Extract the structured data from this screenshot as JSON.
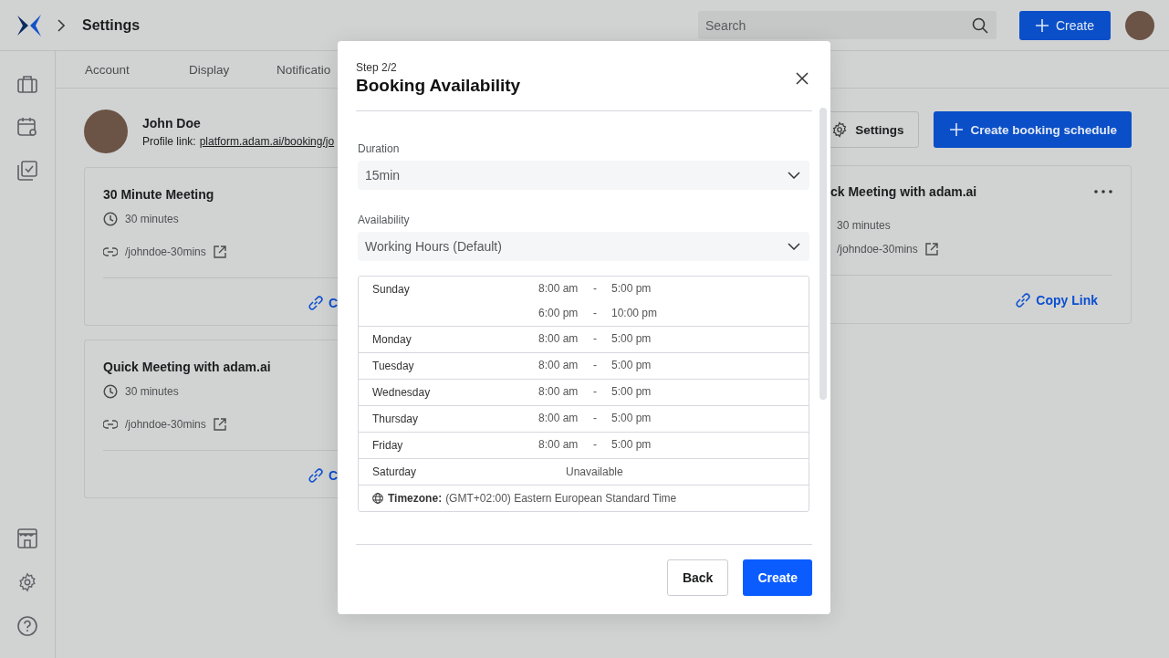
{
  "header": {
    "breadcrumb": "Settings",
    "search": {
      "placeholder": "Search"
    },
    "create_button": "Create"
  },
  "tabs": [
    {
      "label": "Account",
      "selected": false
    },
    {
      "label": "Display",
      "selected": false
    },
    {
      "label": "Notificatio",
      "selected": false
    }
  ],
  "profile": {
    "name": "John Doe",
    "link_label": "Profile link:",
    "link": "platform.adam.ai/booking/jo"
  },
  "actions": {
    "settings_button": "Settings",
    "create_schedule_button": "Create booking schedule"
  },
  "left_cards": [
    {
      "title": "30 Minute Meeting",
      "duration": "30 minutes",
      "slug": "/johndoe-30mins",
      "copy_link": "C"
    },
    {
      "title": "Quick Meeting with adam.ai",
      "duration": "30 minutes",
      "slug": "/johndoe-30mins",
      "copy_link": "C"
    }
  ],
  "right_card": {
    "title": "ck Meeting with adam.ai",
    "duration": "30 minutes",
    "slug": "/johndoe-30mins",
    "copy_link": "Copy Link"
  },
  "modal": {
    "step": "Step 2/2",
    "title": "Booking Availability",
    "duration": {
      "label": "Duration",
      "value": "15min"
    },
    "availability": {
      "label": "Availability",
      "value": "Working Hours (Default)"
    },
    "schedule": [
      {
        "day": "Sunday",
        "kind": "hours",
        "slots": [
          {
            "start": "8:00 am",
            "sep": "-",
            "end": "5:00 pm"
          },
          {
            "start": "6:00 pm",
            "sep": "-",
            "end": "10:00 pm"
          }
        ]
      },
      {
        "day": "Monday",
        "kind": "hours",
        "slots": [
          {
            "start": "8:00 am",
            "sep": "-",
            "end": "5:00 pm"
          }
        ]
      },
      {
        "day": "Tuesday",
        "kind": "hours",
        "slots": [
          {
            "start": "8:00 am",
            "sep": "-",
            "end": "5:00 pm"
          }
        ]
      },
      {
        "day": "Wednesday",
        "kind": "hours",
        "slots": [
          {
            "start": "8:00 am",
            "sep": "-",
            "end": "5:00 pm"
          }
        ]
      },
      {
        "day": "Thursday",
        "kind": "hours",
        "slots": [
          {
            "start": "8:00 am",
            "sep": "-",
            "end": "5:00 pm"
          }
        ]
      },
      {
        "day": "Friday",
        "kind": "hours",
        "slots": [
          {
            "start": "8:00 am",
            "sep": "-",
            "end": "5:00 pm"
          }
        ]
      },
      {
        "day": "Saturday",
        "kind": "unavailable",
        "status": "Unavailable"
      }
    ],
    "timezone": {
      "label": "Timezone:",
      "value": "(GMT+02:00) Eastern European Standard Time"
    },
    "buttons": {
      "back": "Back",
      "create": "Create"
    }
  }
}
